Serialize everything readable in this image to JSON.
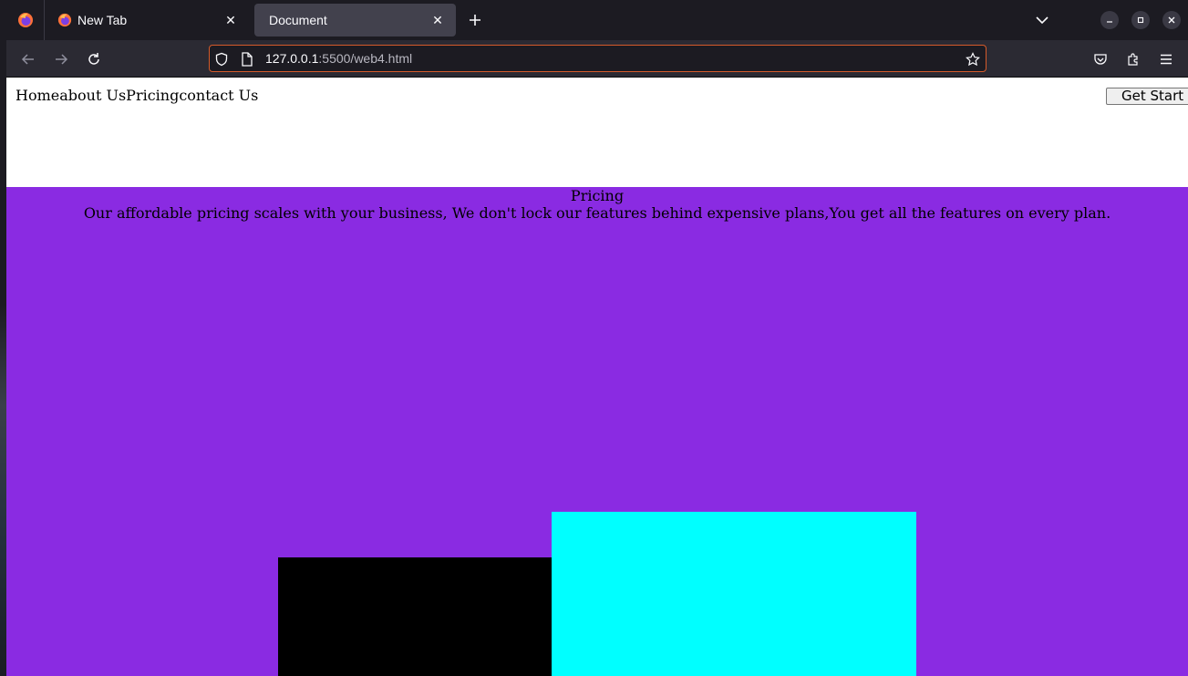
{
  "browser": {
    "tabs": [
      {
        "title": "New Tab",
        "active": false
      },
      {
        "title": "Document",
        "active": true
      }
    ],
    "url": {
      "host": "127.0.0.1",
      "rest": ":5500/web4.html"
    },
    "icons": {
      "app_menu": "firefox-icon",
      "back": "back-arrow-icon",
      "forward": "forward-arrow-icon",
      "reload": "reload-icon",
      "tracking": "shield-icon",
      "page": "page-icon",
      "bookmark": "star-icon",
      "pocket": "pocket-icon",
      "extensions": "puzzle-icon",
      "menu": "hamburger-icon"
    }
  },
  "site": {
    "nav": [
      "Home",
      "about Us",
      "Pricing",
      "contact Us"
    ],
    "cta": "Get Start",
    "pricing_title": "Pricing",
    "pricing_desc": "Our affordable pricing scales with your business, We don't lock our features behind expensive plans,You get all the features on every plan."
  },
  "colors": {
    "pricing_bg": "#8a2be2",
    "card_black": "#000000",
    "card_cyan": "#00ffff",
    "urlbar_focus": "#d45a2a"
  }
}
